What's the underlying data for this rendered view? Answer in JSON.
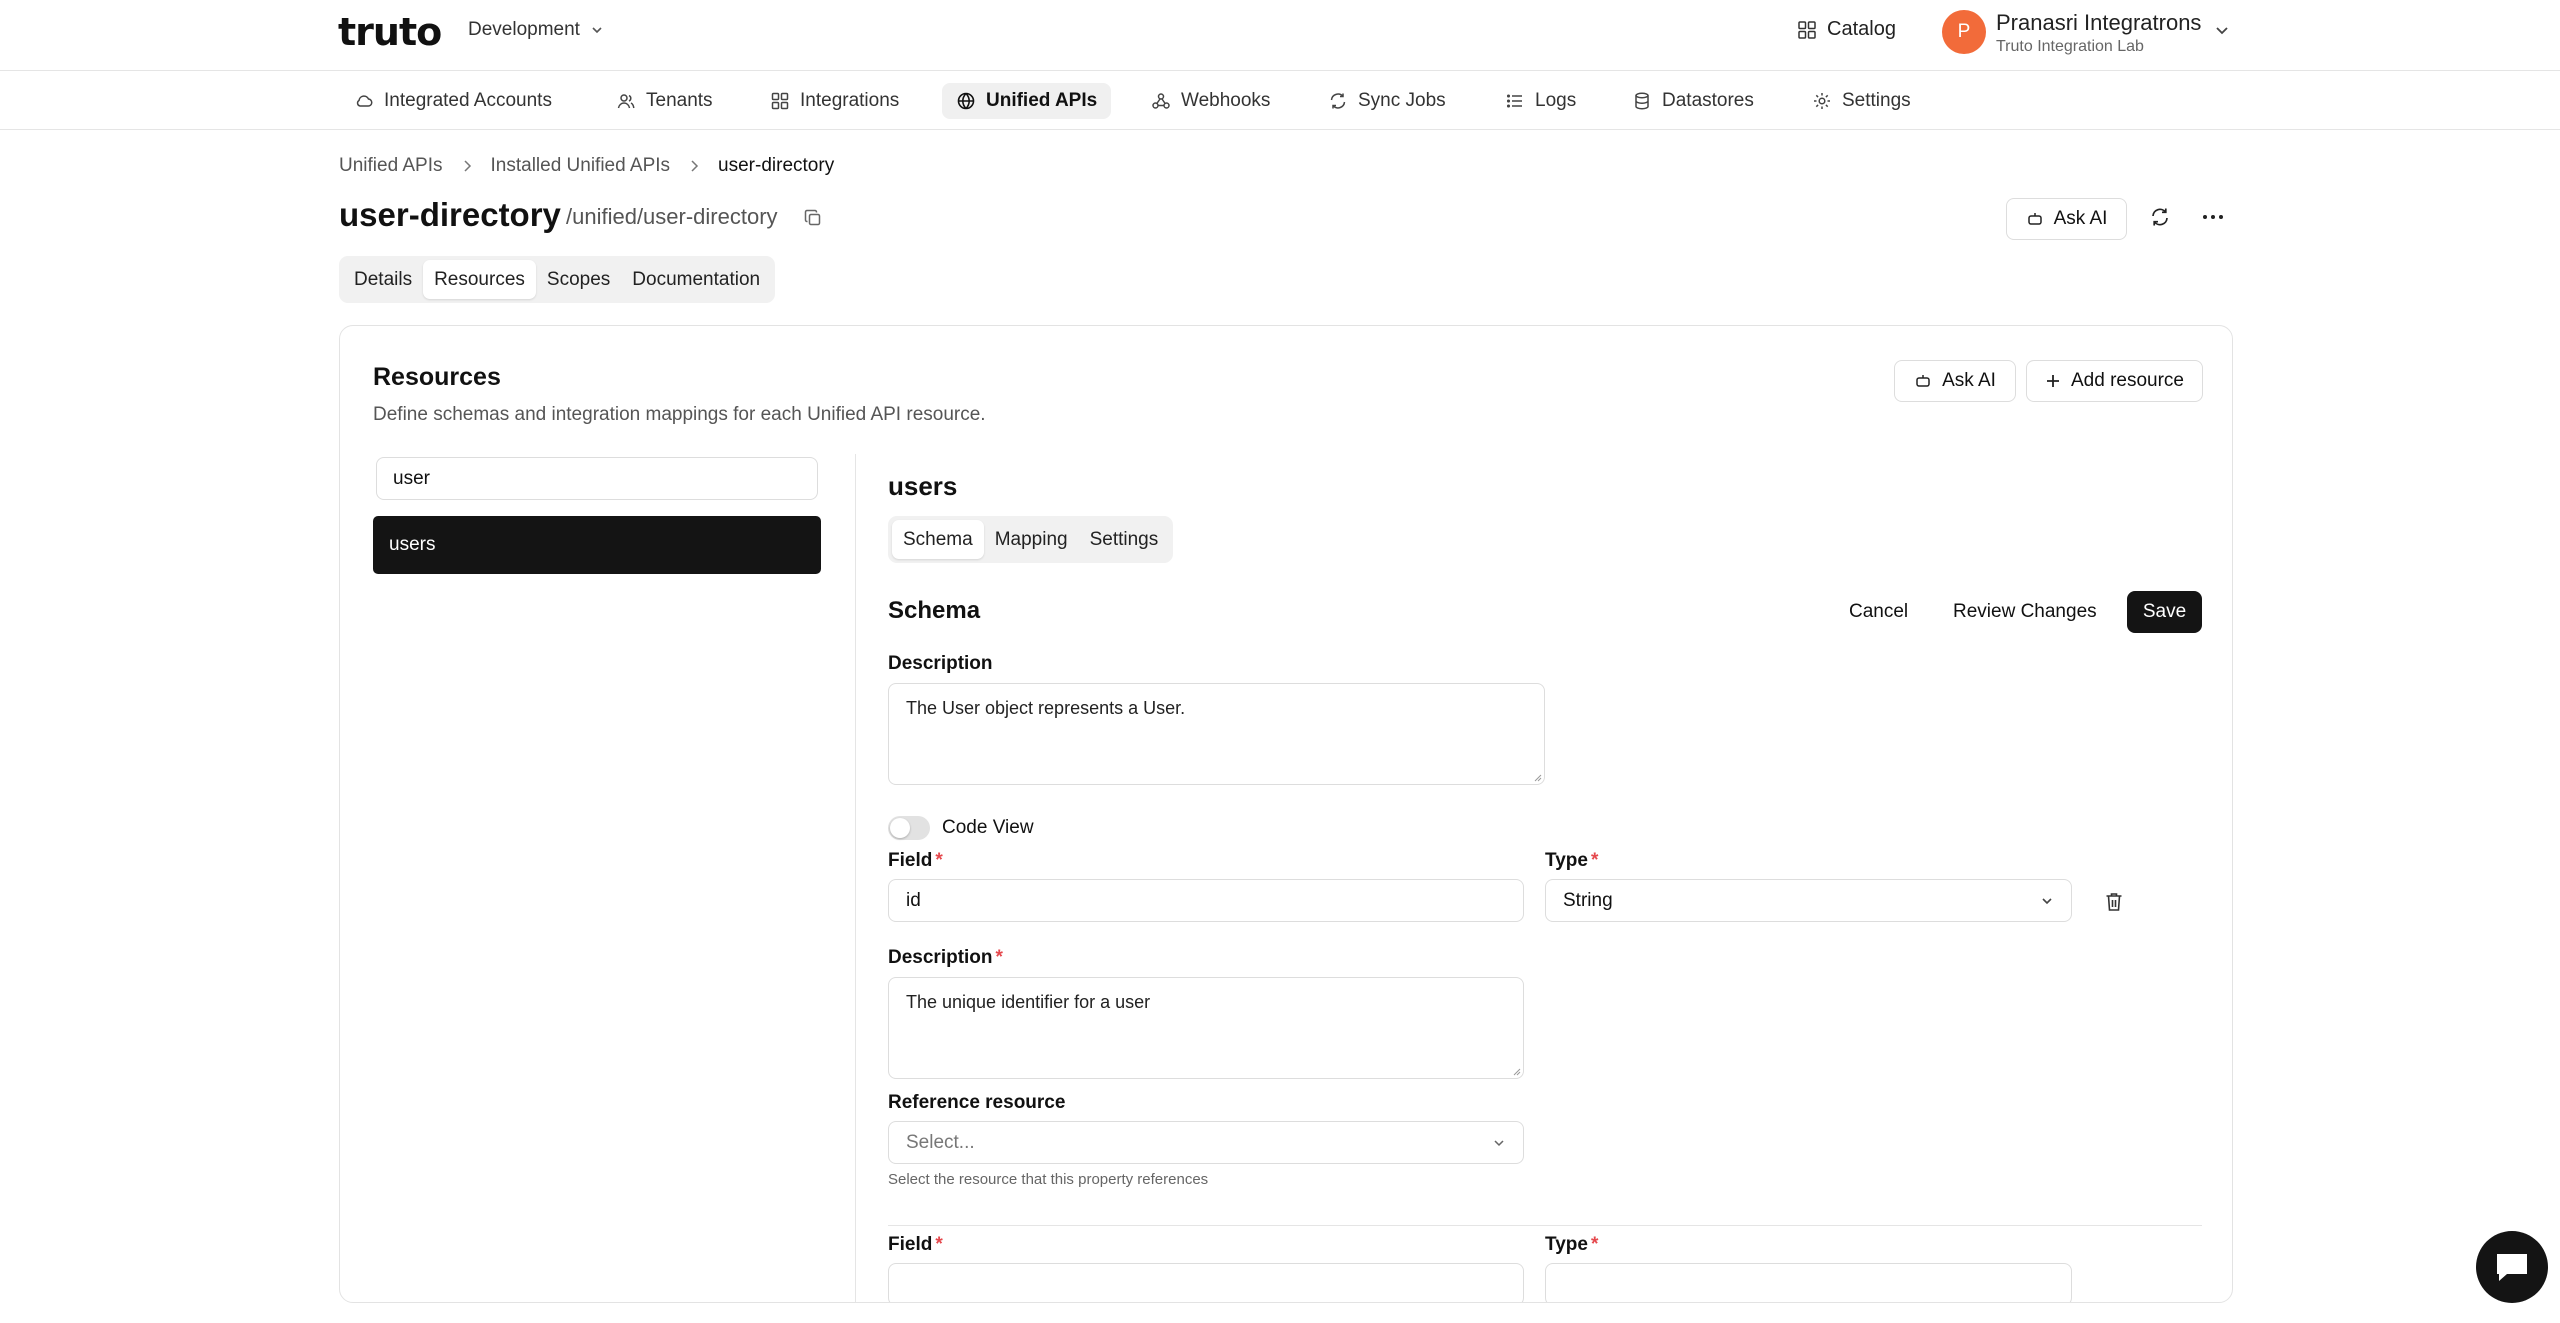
{
  "header": {
    "logo_text": "truto",
    "environment": "Development",
    "catalog_label": "Catalog",
    "user_initial": "P",
    "user_name": "Pranasri Integratrons",
    "user_org": "Truto Integration Lab"
  },
  "nav": {
    "items": [
      {
        "label": "Integrated Accounts",
        "icon": "cloud-icon"
      },
      {
        "label": "Tenants",
        "icon": "users-icon"
      },
      {
        "label": "Integrations",
        "icon": "grid-icon"
      },
      {
        "label": "Unified APIs",
        "icon": "globe-icon",
        "active": true
      },
      {
        "label": "Webhooks",
        "icon": "webhook-icon"
      },
      {
        "label": "Sync Jobs",
        "icon": "sync-icon"
      },
      {
        "label": "Logs",
        "icon": "list-icon"
      },
      {
        "label": "Datastores",
        "icon": "database-icon"
      },
      {
        "label": "Settings",
        "icon": "gear-icon"
      }
    ]
  },
  "breadcrumb": [
    "Unified APIs",
    "Installed Unified APIs",
    "user-directory"
  ],
  "page": {
    "title": "user-directory",
    "path": "/unified/user-directory",
    "ask_ai_label": "Ask AI",
    "tabs": [
      "Details",
      "Resources",
      "Scopes",
      "Documentation"
    ],
    "active_tab": "Resources"
  },
  "resources": {
    "title": "Resources",
    "description": "Define schemas and integration mappings for each Unified API resource.",
    "ask_ai_label": "Ask AI",
    "add_label": "Add resource",
    "search_value": "user",
    "list": [
      "users"
    ]
  },
  "resource": {
    "name": "users",
    "tabs": [
      "Schema",
      "Mapping",
      "Settings"
    ],
    "active_tab": "Schema"
  },
  "schema": {
    "title": "Schema",
    "cancel_label": "Cancel",
    "review_label": "Review Changes",
    "save_label": "Save",
    "description_label": "Description",
    "description_value": "The User object represents a User.",
    "code_view_label": "Code View",
    "field_label": "Field",
    "type_label": "Type",
    "field_value": "id",
    "type_value": "String",
    "field_desc_label": "Description",
    "field_desc_value": "The unique identifier for a user",
    "ref_label": "Reference resource",
    "ref_placeholder": "Select...",
    "ref_help": "Select the resource that this property references",
    "next_field_label": "Field",
    "next_type_label": "Type",
    "required_mark": "*"
  },
  "colors": {
    "accent_dark": "#141414",
    "avatar": "#f26b3a",
    "required": "#e5484d"
  }
}
